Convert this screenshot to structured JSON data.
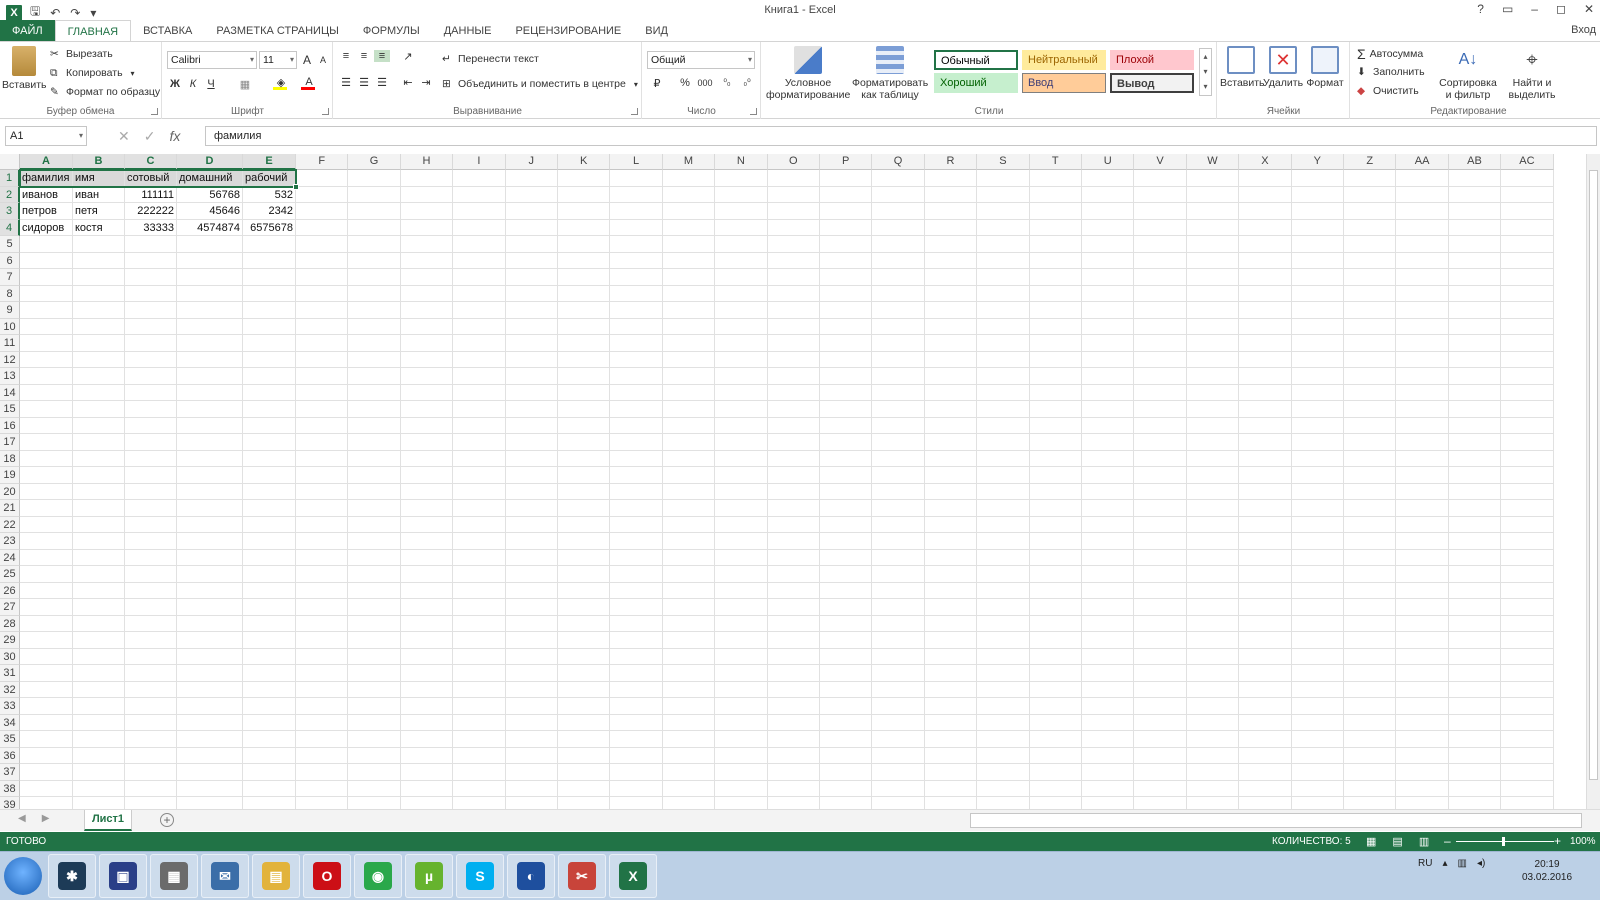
{
  "window": {
    "title": "Книга1 - Excel",
    "controls": [
      "?",
      "▭",
      "–",
      "◻",
      "✕"
    ],
    "signin": "Вход"
  },
  "qat": {
    "undo": "↶",
    "redo": "↷",
    "more": "₹"
  },
  "tabs": [
    "ФАЙЛ",
    "ГЛАВНАЯ",
    "ВСТАВКА",
    "РАЗМЕТКА СТРАНИЦЫ",
    "ФОРМУЛЫ",
    "ДАННЫЕ",
    "РЕЦЕНЗИРОВАНИЕ",
    "ВИД"
  ],
  "ribbon": {
    "clipboard": {
      "label": "Буфер обмена",
      "paste": "Вставить",
      "cut": "Вырезать",
      "copy": "Копировать",
      "format_painter": "Формат по образцу"
    },
    "font": {
      "label": "Шрифт",
      "name": "Calibri",
      "size": "11",
      "bold": "Ж",
      "italic": "К",
      "underline": "Ч",
      "grow": "A",
      "shrink": "A",
      "fill_color": "#ffff00",
      "font_color": "#ff0000"
    },
    "alignment": {
      "label": "Выравнивание",
      "wrap": "Перенести текст",
      "merge": "Объединить и поместить в центре"
    },
    "number": {
      "label": "Число",
      "format": "Общий",
      "percent": "%",
      "thousands": "000"
    },
    "styles": {
      "label": "Стили",
      "conditional": "Условное форматирование",
      "format_table": "Форматировать как таблицу",
      "cells": [
        {
          "name": "Обычный",
          "bg": "#ffffff",
          "fg": "#000000",
          "border": "#217346"
        },
        {
          "name": "Нейтральный",
          "bg": "#ffeb9c",
          "fg": "#9c6500",
          "border": "#ffeb9c"
        },
        {
          "name": "Плохой",
          "bg": "#ffc7ce",
          "fg": "#9c0006",
          "border": "#ffc7ce"
        },
        {
          "name": "Хороший",
          "bg": "#c6efce",
          "fg": "#006100",
          "border": "#c6efce"
        },
        {
          "name": "Ввод",
          "bg": "#ffcc99",
          "fg": "#3f3f76",
          "border": "#7f7f7f"
        },
        {
          "name": "Вывод",
          "bg": "#f2f2f2",
          "fg": "#3f3f3f",
          "border": "#3f3f3f"
        }
      ]
    },
    "cells_group": {
      "label": "Ячейки",
      "insert": "Вставить",
      "delete": "Удалить",
      "format": "Формат"
    },
    "editing": {
      "label": "Редактирование",
      "autosum": "Автосумма",
      "fill": "Заполнить",
      "clear": "Очистить",
      "sort": "Сортировка и фильтр",
      "find": "Найти и выделить"
    }
  },
  "formula_bar": {
    "name_box": "A1",
    "fx": "fx",
    "value": "фамилия"
  },
  "columns": [
    "A",
    "B",
    "C",
    "D",
    "E",
    "F",
    "G",
    "H",
    "I",
    "J",
    "K",
    "L",
    "M",
    "N",
    "O",
    "P",
    "Q",
    "R",
    "S",
    "T",
    "U",
    "V",
    "W",
    "X",
    "Y",
    "Z",
    "AA",
    "AB",
    "AC"
  ],
  "rows_count": 39,
  "data": [
    [
      "фамилия",
      "имя",
      "сотовый",
      "домашний",
      "рабочий"
    ],
    [
      "иванов",
      "иван",
      "111111",
      "56768",
      "532"
    ],
    [
      "петров",
      "петя",
      "222222",
      "45646",
      "2342"
    ],
    [
      "сидоров",
      "костя",
      "33333",
      "4574874",
      "6575678"
    ]
  ],
  "sheet": {
    "tab": "Лист1",
    "add": "+"
  },
  "status": {
    "ready": "ГОТОВО",
    "count": "КОЛИЧЕСТВО: 5",
    "zoom": "100%",
    "zoom_minus": "–",
    "zoom_plus": "+"
  },
  "taskbar": {
    "lang": "RU",
    "time": "20:19",
    "date": "03.02.2016",
    "apps": [
      {
        "name": "dark",
        "color": "#1d3b57",
        "glyph": "✱"
      },
      {
        "name": "save",
        "color": "#2a3f88",
        "glyph": "▣"
      },
      {
        "name": "calc",
        "color": "#6b6b6b",
        "glyph": "▦"
      },
      {
        "name": "thunderbird",
        "color": "#3b6ea8",
        "glyph": "✉"
      },
      {
        "name": "explorer",
        "color": "#e2b33c",
        "glyph": "▤"
      },
      {
        "name": "opera",
        "color": "#cc0f16",
        "glyph": "O"
      },
      {
        "name": "chrome",
        "color": "#2aa84a",
        "glyph": "◉"
      },
      {
        "name": "utorrent",
        "color": "#66b32e",
        "glyph": "µ"
      },
      {
        "name": "skype",
        "color": "#00aff0",
        "glyph": "S"
      },
      {
        "name": "media",
        "color": "#1e4f9e",
        "glyph": "◐"
      },
      {
        "name": "tools",
        "color": "#c8443a",
        "glyph": "✂"
      },
      {
        "name": "excel",
        "color": "#217346",
        "glyph": "X"
      }
    ]
  }
}
